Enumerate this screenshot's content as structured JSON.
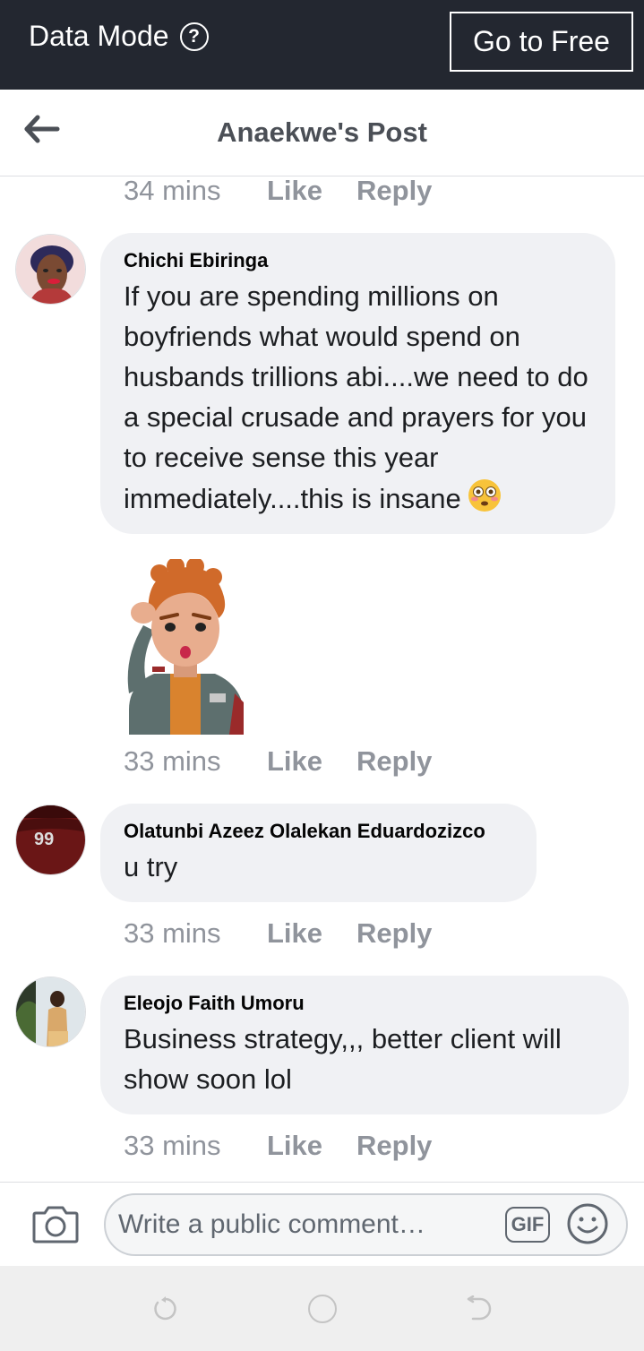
{
  "status_bar": {
    "data_mode_label": "Data Mode",
    "help_symbol": "?",
    "go_to_free_label": "Go to Free"
  },
  "header": {
    "title": "Anaekwe's Post",
    "back_icon": "back-arrow-icon"
  },
  "actions": {
    "like": "Like",
    "reply": "Reply"
  },
  "comments": [
    {
      "time": "34 mins"
    },
    {
      "author": "Chichi Ebiringa",
      "text": "If you are spending millions on boyfriends what would spend on husbands trillions abi....we need to do a special crusade and prayers for you to receive sense this year immediately....this is insane",
      "emoji": "flushed-face-emoji",
      "sticker": "avatar-sticker-thinking",
      "time": "33 mins"
    },
    {
      "author": "Olatunbi Azeez Olalekan Eduardozizco",
      "text": "u try",
      "avatar_text": "99",
      "time": "33 mins"
    },
    {
      "author": "Eleojo Faith Umoru",
      "text": "Business strategy,,, better client will show soon lol",
      "time": "33 mins"
    }
  ],
  "composer": {
    "placeholder": "Write a public comment…",
    "gif_label": "GIF",
    "camera_icon": "camera-icon",
    "emoji_icon": "smiley-icon"
  },
  "colors": {
    "top_bar": "#232730",
    "bubble": "#f0f1f4",
    "meta_text": "#90949c",
    "title_text": "#4b4f56"
  }
}
